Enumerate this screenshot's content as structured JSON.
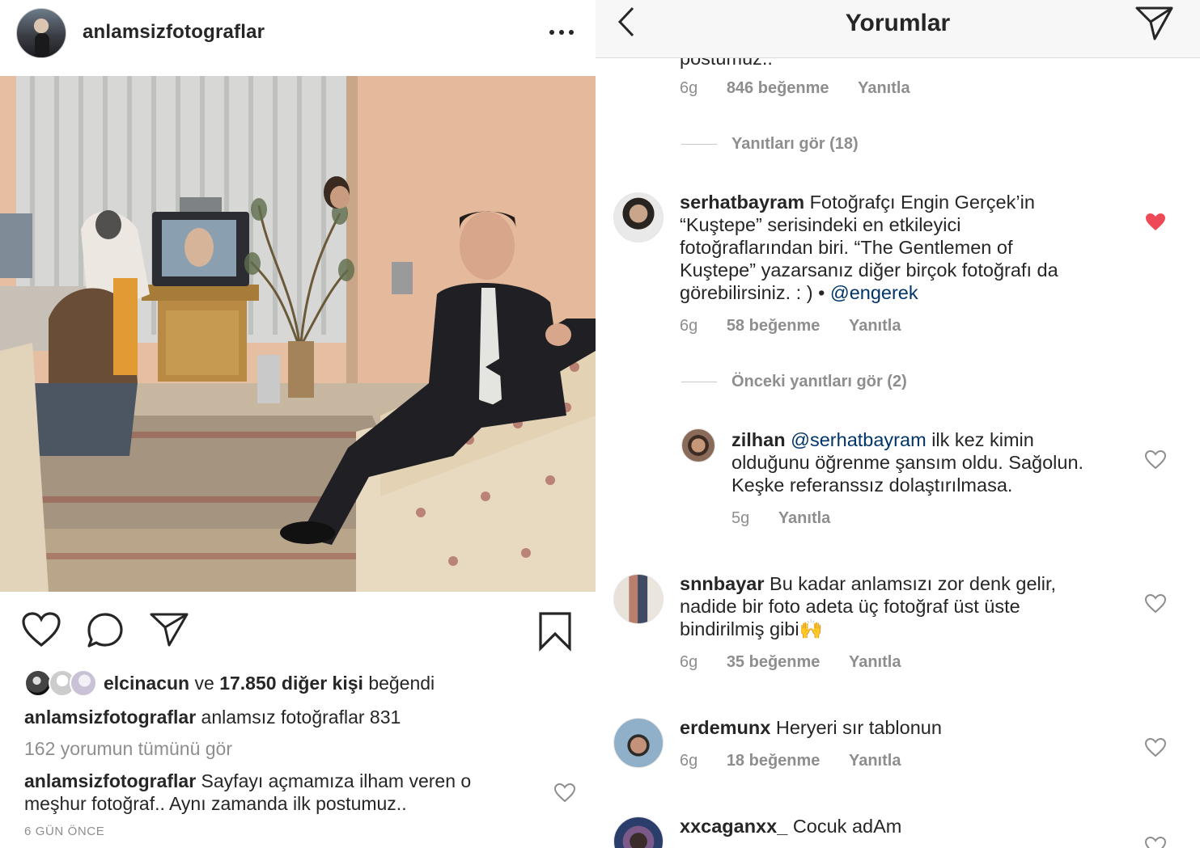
{
  "post": {
    "username": "anlamsizfotograflar",
    "likes": {
      "first_liker": "elcinacun",
      "conj": "ve",
      "others": "17.850 diğer kişi",
      "suffix": "beğendi"
    },
    "caption": {
      "username": "anlamsizfotograflar",
      "text": "anlamsız fotoğraflar 831"
    },
    "view_all": "162 yorumun tümünü gör",
    "preview_comment": {
      "username": "anlamsizfotograflar",
      "text_line1": "Sayfayı açmamıza ilham veren o",
      "text_line2": "meşhur fotoğraf.. Aynı zamanda ilk postumuz.."
    },
    "timestamp": "6 GÜN ÖNCE"
  },
  "comments_screen": {
    "title": "Yorumlar",
    "top_partial": {
      "text": "postumuz..",
      "time": "6g",
      "likes": "846 beğenme",
      "reply": "Yanıtla"
    },
    "view_replies_1": "Yanıtları gör (18)",
    "comments": [
      {
        "username": "serhatbayram",
        "line1": "Fotoğrafçı Engin Gerçek’in",
        "line2": "“Kuştepe” serisindeki en etkileyici",
        "line3": "fotoğraflarından biri. “The Gentlemen of",
        "line4": "Kuştepe” yazarsanız diğer birçok fotoğrafı da",
        "line5": "görebilirsiniz. : ) •",
        "mention": "@engerek",
        "time": "6g",
        "likes": "58 beğenme",
        "reply": "Yanıtla",
        "liked": true
      },
      {
        "username": "zilhan",
        "mention": "@serhatbayram",
        "line1": "ilk kez kimin",
        "line2": "olduğunu öğrenme şansım oldu. Sağolun.",
        "line3": "Keşke referanssız dolaştırılmasa.",
        "time": "5g",
        "reply": "Yanıtla"
      },
      {
        "username": "snnbayar",
        "line1": "Bu kadar anlamsızı zor denk gelir,",
        "line2": "nadide bir foto adeta üç fotoğraf üst üste",
        "line3": "bindirilmiş gibi",
        "emoji": "🙌",
        "time": "6g",
        "likes": "35 beğenme",
        "reply": "Yanıtla"
      },
      {
        "username": "erdemunx",
        "line1": "Heryeri sır tablonun",
        "time": "6g",
        "likes": "18 beğenme",
        "reply": "Yanıtla"
      },
      {
        "username": "xxcaganxx_",
        "line1": "Cocuk adAm"
      }
    ],
    "view_prev_replies": "Önceki yanıtları gör (2)"
  },
  "colors": {
    "liked_heart": "#ed4956",
    "mention": "#003569",
    "muted": "#8e8e8e"
  }
}
